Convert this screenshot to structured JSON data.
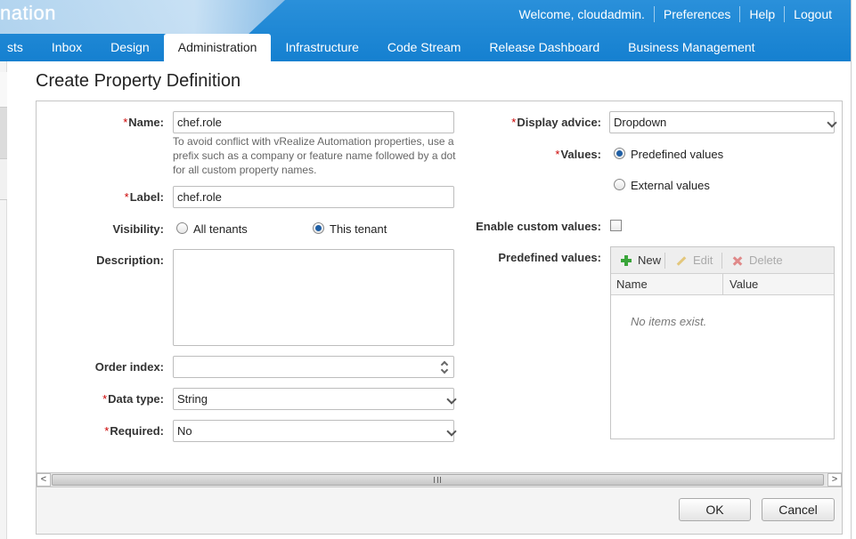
{
  "header": {
    "logo_text": "nation",
    "welcome": "Welcome, cloudadmin.",
    "links": [
      "Preferences",
      "Help",
      "Logout"
    ]
  },
  "tabs": [
    {
      "label": "sts"
    },
    {
      "label": "Inbox"
    },
    {
      "label": "Design"
    },
    {
      "label": "Administration",
      "active": true
    },
    {
      "label": "Infrastructure"
    },
    {
      "label": "Code Stream"
    },
    {
      "label": "Release Dashboard"
    },
    {
      "label": "Business Management"
    }
  ],
  "page": {
    "title": "Create Property Definition"
  },
  "form": {
    "name": {
      "label": "Name:",
      "value": "chef.role",
      "help": "To avoid conflict with vRealize Automation properties, use a prefix such as a company or feature name followed by a dot for all custom property names."
    },
    "label_field": {
      "label": "Label:",
      "value": "chef.role"
    },
    "visibility": {
      "label": "Visibility:",
      "options": [
        "All tenants",
        "This tenant"
      ],
      "selected": "This tenant"
    },
    "description": {
      "label": "Description:",
      "value": ""
    },
    "order_index": {
      "label": "Order index:",
      "value": ""
    },
    "data_type": {
      "label": "Data type:",
      "value": "String"
    },
    "required": {
      "label": "Required:",
      "value": "No"
    },
    "display_advice": {
      "label": "Display advice:",
      "value": "Dropdown"
    },
    "values": {
      "label": "Values:",
      "options": [
        "Predefined values",
        "External values"
      ],
      "selected": "Predefined values"
    },
    "enable_custom": {
      "label": "Enable custom values:",
      "checked": false
    },
    "predefined": {
      "label": "Predefined values:",
      "toolbar": {
        "new": "New",
        "edit": "Edit",
        "delete": "Delete"
      },
      "columns": [
        "Name",
        "Value"
      ],
      "empty": "No items exist."
    }
  },
  "buttons": {
    "ok": "OK",
    "cancel": "Cancel"
  },
  "colors": {
    "header_blue": "#1a86d6",
    "required_star": "#cc0000",
    "radio_selected": "#1f5fa5"
  }
}
